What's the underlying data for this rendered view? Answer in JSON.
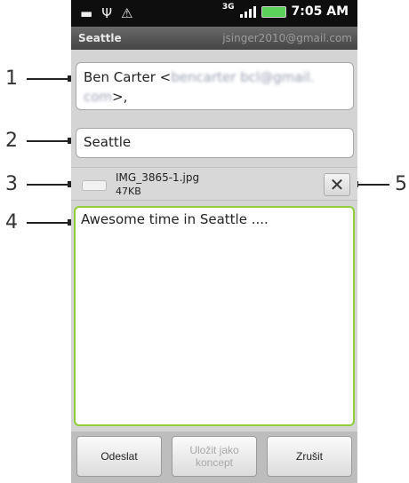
{
  "status_bar": {
    "network": "3G",
    "time": "7:05 AM",
    "icons": [
      "picture-icon",
      "usb-icon",
      "warning-icon"
    ]
  },
  "title_bar": {
    "title": "Seattle",
    "account": "jsinger2010@gmail.com"
  },
  "compose": {
    "to_name": "Ben  Carter <",
    "to_email_blurred_line1": "bencarter bcl@gmail.",
    "to_email_blurred_line2": "com",
    "to_suffix": ">,",
    "subject": "Seattle",
    "attachment": {
      "filename": "IMG_3865-1.jpg",
      "size": "47KB",
      "remove_label": "✕"
    },
    "body": "Awesome time in Seattle ...."
  },
  "buttons": {
    "send": "Odeslat",
    "save_draft": "Uložit jako koncept",
    "cancel": "Zrušit"
  },
  "callouts": [
    "1",
    "2",
    "3",
    "4",
    "5"
  ],
  "colors": {
    "status_bar_bg": "#0e0e0e",
    "focus_border": "#8fce3a",
    "battery": "#5bd35b"
  }
}
